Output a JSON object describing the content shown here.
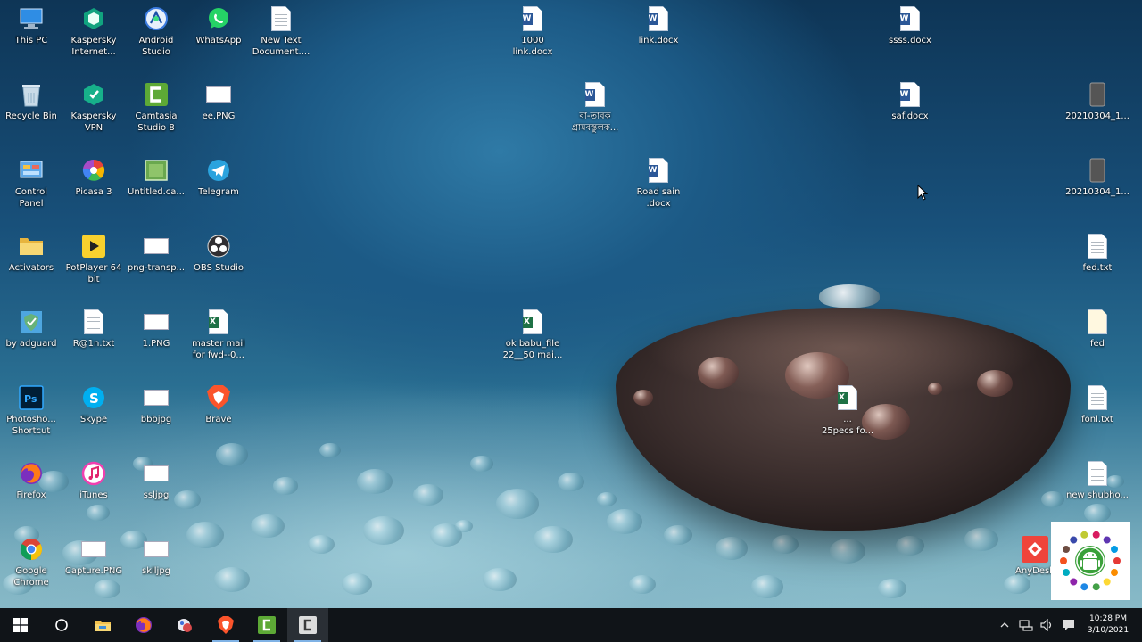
{
  "desktop": {
    "icons_left": [
      {
        "id": "this-pc",
        "label": "This PC",
        "icon": "computer-icon"
      },
      {
        "id": "kaspersky-internet",
        "label": "Kaspersky\nInternet...",
        "icon": "kaspersky-icon"
      },
      {
        "id": "android-studio",
        "label": "Android\nStudio",
        "icon": "android-studio-icon"
      },
      {
        "id": "whatsapp",
        "label": "WhatsApp",
        "icon": "whatsapp-icon"
      },
      {
        "id": "new-text-document",
        "label": "New Text\nDocument....",
        "icon": "text-file-icon"
      },
      {
        "id": "recycle-bin",
        "label": "Recycle Bin",
        "icon": "recycle-bin-icon"
      },
      {
        "id": "kaspersky-vpn",
        "label": "Kaspersky\nVPN",
        "icon": "kaspersky-vpn-icon"
      },
      {
        "id": "camtasia",
        "label": "Camtasia\nStudio 8",
        "icon": "camtasia-icon"
      },
      {
        "id": "ee-png",
        "label": "ee.PNG",
        "icon": "image-file-icon"
      },
      {
        "id": "control-panel",
        "label": "Control\nPanel",
        "icon": "control-panel-icon"
      },
      {
        "id": "picasa",
        "label": "Picasa 3",
        "icon": "picasa-icon"
      },
      {
        "id": "untitled-ca",
        "label": "Untitled.ca...",
        "icon": "camtasia-project-icon"
      },
      {
        "id": "telegram",
        "label": "Telegram",
        "icon": "telegram-icon"
      },
      {
        "id": "activators",
        "label": "Activators",
        "icon": "folder-icon"
      },
      {
        "id": "potplayer",
        "label": "PotPlayer 64\nbit",
        "icon": "potplayer-icon"
      },
      {
        "id": "png-transp",
        "label": "png-transp...",
        "icon": "image-file-icon"
      },
      {
        "id": "obs-studio",
        "label": "OBS Studio",
        "icon": "obs-icon"
      },
      {
        "id": "by-adguard",
        "label": "by adguard",
        "icon": "adguard-icon"
      },
      {
        "id": "r-at-1n-txt",
        "label": "R@1n.txt",
        "icon": "text-file-icon"
      },
      {
        "id": "1-png",
        "label": "1.PNG",
        "icon": "image-file-icon"
      },
      {
        "id": "master-mail",
        "label": "master mail\nfor fwd--0...",
        "icon": "excel-file-icon"
      },
      {
        "id": "photoshop-shortcut",
        "label": "Photosho...\nShortcut",
        "icon": "photoshop-icon"
      },
      {
        "id": "skype",
        "label": "Skype",
        "icon": "skype-icon"
      },
      {
        "id": "bbbjpg",
        "label": "bbbjpg",
        "icon": "image-file-icon"
      },
      {
        "id": "brave",
        "label": "Brave",
        "icon": "brave-icon"
      },
      {
        "id": "firefox",
        "label": "Firefox",
        "icon": "firefox-icon"
      },
      {
        "id": "itunes",
        "label": "iTunes",
        "icon": "itunes-icon"
      },
      {
        "id": "ssljpg",
        "label": "ssljpg",
        "icon": "image-file-icon"
      },
      {
        "id": "google-chrome",
        "label": "Google\nChrome",
        "icon": "chrome-icon"
      },
      {
        "id": "capture-png",
        "label": "Capture.PNG",
        "icon": "image-file-icon"
      },
      {
        "id": "sklljpg",
        "label": "sklljpg",
        "icon": "image-file-icon"
      }
    ],
    "icons_files": [
      {
        "id": "1000-link-docx",
        "label": "1000\nlink.docx",
        "icon": "word-file-icon"
      },
      {
        "id": "link-docx",
        "label": "link.docx",
        "icon": "word-file-icon"
      },
      {
        "id": "ssss-docx",
        "label": "ssss.docx",
        "icon": "word-file-icon"
      },
      {
        "id": "bangla-docx",
        "label": "বা-তাবক\nগ্রামবস্তুলক...",
        "icon": "word-file-icon"
      },
      {
        "id": "saf-docx",
        "label": "saf.docx",
        "icon": "word-file-icon"
      },
      {
        "id": "20210304-1a",
        "label": "20210304_1...",
        "icon": "phone-image-icon"
      },
      {
        "id": "road-sain-docx",
        "label": "Road sain\n.docx",
        "icon": "word-file-icon"
      },
      {
        "id": "20210304-1b",
        "label": "20210304_1...",
        "icon": "phone-image-icon"
      },
      {
        "id": "fed-txt",
        "label": "fed.txt",
        "icon": "text-file-icon"
      },
      {
        "id": "fed-folder",
        "label": "fed",
        "icon": "file-icon"
      },
      {
        "id": "ok-babu-file",
        "label": "ok babu_file\n22__50 mai...",
        "icon": "excel-file-icon"
      },
      {
        "id": "fonl-txt",
        "label": "fonl.txt",
        "icon": "text-file-icon"
      },
      {
        "id": "specs-file",
        "label": "...\n25pecs fo...",
        "icon": "excel-file-icon"
      },
      {
        "id": "new-shubho",
        "label": "new shubho...",
        "icon": "text-file-icon"
      },
      {
        "id": "anydesk",
        "label": "AnyDesk",
        "icon": "anydesk-icon"
      }
    ]
  },
  "taskbar": {
    "buttons": [
      {
        "id": "start",
        "icon": "windows-start-icon"
      },
      {
        "id": "search",
        "icon": "cortana-search-icon"
      },
      {
        "id": "file-explorer",
        "icon": "folder-icon"
      },
      {
        "id": "firefox",
        "icon": "firefox-icon"
      },
      {
        "id": "settings-app",
        "icon": "app-icon"
      },
      {
        "id": "brave",
        "icon": "brave-icon"
      },
      {
        "id": "camtasia",
        "icon": "camtasia-icon"
      },
      {
        "id": "camtasia-recorder",
        "icon": "camtasia-recorder-icon"
      }
    ],
    "clock": {
      "time": "10:28 PM",
      "date": "3/10/2021"
    }
  },
  "colors": {
    "taskbar_bg": "#101418",
    "running_indicator": "#7fb2e5",
    "word_blue": "#2b5797",
    "excel_green": "#1e7145"
  }
}
